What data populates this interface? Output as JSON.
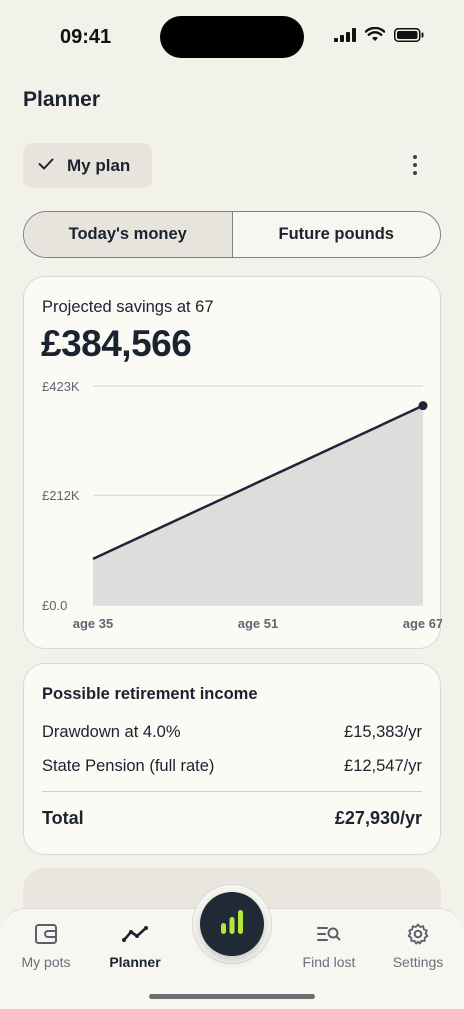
{
  "status": {
    "time": "09:41"
  },
  "page": {
    "title": "Planner"
  },
  "plan_chip": {
    "label": "My plan",
    "icon": "check-icon"
  },
  "menu": {
    "icon": "kebab-menu-icon"
  },
  "toggle": {
    "options": [
      "Today's money",
      "Future pounds"
    ],
    "selected": "Today's money"
  },
  "projection": {
    "label": "Projected savings at 67",
    "value": "£384,566"
  },
  "chart_data": {
    "type": "area",
    "x": [
      35,
      67
    ],
    "x_tick_labels": [
      "age 35",
      "age 51",
      "age 67"
    ],
    "x_tick_values": [
      35,
      51,
      67
    ],
    "y_tick_labels": [
      "£423K",
      "£212K",
      "£0.0"
    ],
    "y_tick_values": [
      423,
      212,
      0
    ],
    "ylim": [
      0,
      423
    ],
    "y_unit": "£K",
    "series": [
      {
        "x": [
          35,
          67
        ],
        "values": [
          89,
          385
        ]
      }
    ],
    "grid": true,
    "colors": {
      "line": "#1b2738",
      "fill": "#dedddb",
      "grid": "#d6d4cc",
      "tick": "#5f6571"
    }
  },
  "income": {
    "title": "Possible retirement income",
    "rows": [
      {
        "label": "Drawdown at 4.0%",
        "value": "£15,383/yr"
      },
      {
        "label": "State Pension (full rate)",
        "value": "£12,547/yr"
      }
    ],
    "total": {
      "label": "Total",
      "value": "£27,930/yr"
    }
  },
  "tabs": [
    {
      "label": "My pots",
      "icon": "wallet-icon",
      "active": false
    },
    {
      "label": "Planner",
      "icon": "trend-line-icon",
      "active": true
    },
    {
      "label": "Find lost",
      "icon": "search-list-icon",
      "active": false
    },
    {
      "label": "Settings",
      "icon": "gear-icon",
      "active": false
    }
  ],
  "fab": {
    "icon": "bar-chart-icon"
  },
  "colors": {
    "background": "#f2f1ea",
    "card": "#fbfaf5",
    "ink": "#1b2230",
    "fab": "#1f2a35",
    "fab_accent": "#b5e63c"
  }
}
